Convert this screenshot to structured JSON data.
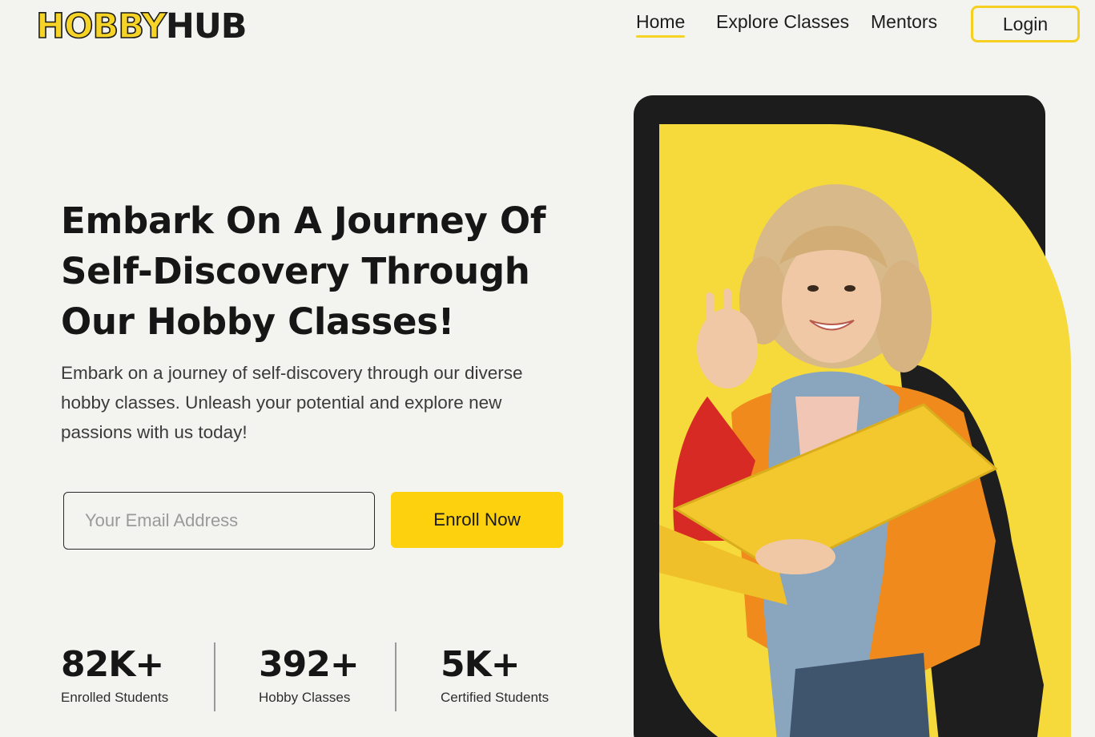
{
  "brand": {
    "part1": "HOBBY",
    "part2": "HUB"
  },
  "nav": {
    "home": "Home",
    "explore": "Explore Classes",
    "mentors": "Mentors",
    "login": "Login"
  },
  "hero": {
    "title_line1": "Embark On A Journey Of",
    "title_line2": "Self-Discovery Through",
    "title_line3": "Our Hobby Classes!",
    "subtitle": "Embark on a journey of self-discovery through our diverse hobby classes. Unleash your potential and explore new passions with us today!",
    "email_placeholder": "Your Email Address",
    "enroll_label": "Enroll Now",
    "image_description_icon": "smiling-student-photo"
  },
  "stats": [
    {
      "value": "82K+",
      "label": "Enrolled Students"
    },
    {
      "value": "392+",
      "label": "Hobby Classes"
    },
    {
      "value": "5K+",
      "label": "Certified Students"
    }
  ],
  "colors": {
    "accent": "#fdd10d",
    "background": "#f3f4f0",
    "dark": "#1c1c1c",
    "text": "#161616"
  }
}
